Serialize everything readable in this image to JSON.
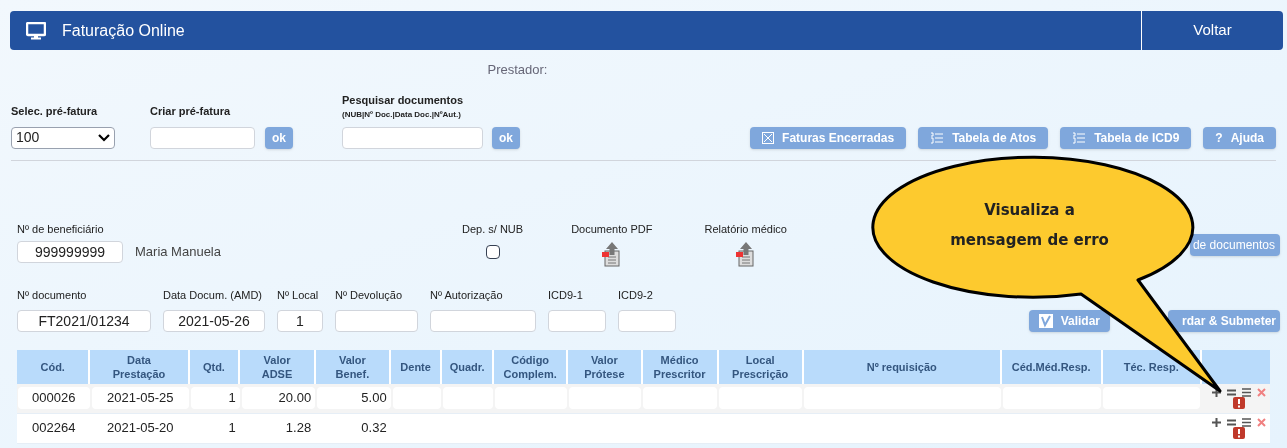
{
  "header": {
    "title": "Faturação Online",
    "back": "Voltar"
  },
  "provider_label": "Prestador:",
  "toolbar": {
    "select_label": "Selec. pré-fatura",
    "select_value": "100",
    "create_label": "Criar pré-fatura",
    "create_ok": "ok",
    "search_label": "Pesquisar documentos",
    "search_hint": "(NUB|Nº Doc.|Data Doc.|NºAut.)",
    "search_ok": "ok",
    "buttons": [
      {
        "label": "Faturas Encerradas",
        "kind": "closed"
      },
      {
        "label": "Tabela de Atos",
        "kind": "list"
      },
      {
        "label": "Tabela de ICD9",
        "kind": "list"
      },
      {
        "label": "Ajuda",
        "kind": "help",
        "icon": "?"
      }
    ]
  },
  "beneficiary": {
    "label": "Nº de beneficiário",
    "value": "999999999",
    "name": "Maria Manuela",
    "dep_label": "Dep. s/ NUB",
    "dep_checked": false,
    "pdf_label": "Documento PDF",
    "report_label": "Relatório médico",
    "docs_button": "de documentos"
  },
  "document_fields": [
    {
      "label": "Nº documento",
      "value": "FT2021/01234"
    },
    {
      "label": "Data Docum. (AMD)",
      "value": "2021-05-26"
    },
    {
      "label": "Nº Local",
      "value": "1"
    },
    {
      "label": "Nº Devolução"
    },
    {
      "label": "Nº Autorização"
    },
    {
      "label": "ICD9-1"
    },
    {
      "label": "ICD9-2"
    }
  ],
  "actions": {
    "validate": "Validar",
    "submit": "rdar & Submeter"
  },
  "table": {
    "columns": [
      "Cód.",
      "Data Prestação",
      "Qtd.",
      "Valor ADSE",
      "Valor Benef.",
      "Dente",
      "Quadr.",
      "Código Complem.",
      "Valor Prótese",
      "Médico Prescritor",
      "Local Prescrição",
      "Nº requisição",
      "Céd.Méd.Resp.",
      "Téc. Resp."
    ],
    "rows": [
      {
        "cells": [
          "000026",
          "2021-05-25",
          "1",
          "20.00",
          "5.00"
        ],
        "has_error": true
      },
      {
        "cells": [
          "002264",
          "2021-05-20",
          "1",
          "1.28",
          "0.32"
        ],
        "has_error": true
      }
    ]
  },
  "callout": {
    "text": "Visualiza a mensagem de erro"
  }
}
